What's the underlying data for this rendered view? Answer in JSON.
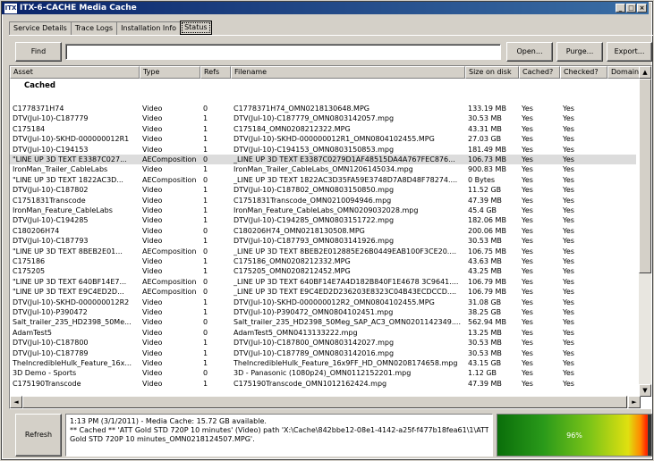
{
  "window": {
    "icon_label": "ITX",
    "title": "ITX-6-CACHE Media Cache",
    "controls": {
      "minimize": "_",
      "maximize": "□",
      "close": "×"
    }
  },
  "tabs": [
    {
      "label": "Service Details",
      "active": false
    },
    {
      "label": "Trace Logs",
      "active": false
    },
    {
      "label": "Installation Info",
      "active": false
    },
    {
      "label": "Status",
      "active": true
    }
  ],
  "toolbar": {
    "find_label": "Find",
    "search_value": "",
    "open_label": "Open...",
    "purge_label": "Purge...",
    "export_label": "Export..."
  },
  "grid": {
    "columns": [
      "Asset",
      "Type",
      "Refs",
      "Filename",
      "Size on disk",
      "Cached?",
      "Checked?",
      "Domain"
    ],
    "group_label": "Cached",
    "rows": [
      [
        "C1778371H74",
        "Video",
        "0",
        "C1778371H74_OMN0218130648.MPG",
        "133.19 MB",
        "Yes",
        "Yes"
      ],
      [
        "DTV(Jul-10)-C187779",
        "Video",
        "1",
        "DTV(Jul-10)-C187779_OMN0803142057.mpg",
        "30.53 MB",
        "Yes",
        "Yes"
      ],
      [
        "C175184",
        "Video",
        "1",
        "C175184_OMN0208212322.MPG",
        "43.31 MB",
        "Yes",
        "Yes"
      ],
      [
        "DTV(Jul-10)-SKHD-000000012R1",
        "Video",
        "1",
        "DTV(Jul-10)-SKHD-000000012R1_OMN0804102455.MPG",
        "27.03 GB",
        "Yes",
        "Yes"
      ],
      [
        "DTV(Jul-10)-C194153",
        "Video",
        "1",
        "DTV(Jul-10)-C194153_OMN0803150853.mpg",
        "181.49 MB",
        "Yes",
        "Yes"
      ],
      [
        "\"LINE UP 3D TEXT E3387C027...",
        "AEComposition",
        "0",
        "_LINE UP 3D TEXT E3387C0279D1AF48515DA4A767FEC876...",
        "106.73 MB",
        "Yes",
        "Yes"
      ],
      [
        "IronMan_Trailer_CableLabs",
        "Video",
        "1",
        "IronMan_Trailer_CableLabs_OMN1206145034.mpg",
        "900.83 MB",
        "Yes",
        "Yes"
      ],
      [
        "\"LINE UP 3D TEXT 1822AC3D...",
        "AEComposition",
        "0",
        "_LINE UP 3D TEXT 1822AC3D35FA59E3748D7A8D48F78274....",
        "0 Bytes",
        "Yes",
        "Yes"
      ],
      [
        "DTV(Jul-10)-C187802",
        "Video",
        "1",
        "DTV(Jul-10)-C187802_OMN0803150850.mpg",
        "11.52 GB",
        "Yes",
        "Yes"
      ],
      [
        "C1751831Transcode",
        "Video",
        "1",
        "C1751831Transcode_OMN0210094946.mpg",
        "47.39 MB",
        "Yes",
        "Yes"
      ],
      [
        "IronMan_Feature_CableLabs",
        "Video",
        "1",
        "IronMan_Feature_CableLabs_OMN0209032028.mpg",
        "45.4 GB",
        "Yes",
        "Yes"
      ],
      [
        "DTV(Jul-10)-C194285",
        "Video",
        "1",
        "DTV(Jul-10)-C194285_OMN0803151722.mpg",
        "182.06 MB",
        "Yes",
        "Yes"
      ],
      [
        "C180206H74",
        "Video",
        "0",
        "C180206H74_OMN0218130508.MPG",
        "200.06 MB",
        "Yes",
        "Yes"
      ],
      [
        "DTV(Jul-10)-C187793",
        "Video",
        "1",
        "DTV(Jul-10)-C187793_OMN0803141926.mpg",
        "30.53 MB",
        "Yes",
        "Yes"
      ],
      [
        "\"LINE UP 3D TEXT 8BEB2E01...",
        "AEComposition",
        "0",
        "_LINE UP 3D TEXT 8BEB2E012885E26B0449EAB100F3CE20....",
        "106.75 MB",
        "Yes",
        "Yes"
      ],
      [
        "C175186",
        "Video",
        "1",
        "C175186_OMN0208212332.MPG",
        "43.63 MB",
        "Yes",
        "Yes"
      ],
      [
        "C175205",
        "Video",
        "1",
        "C175205_OMN0208212452.MPG",
        "43.25 MB",
        "Yes",
        "Yes"
      ],
      [
        "\"LINE UP 3D TEXT 640BF14E7...",
        "AEComposition",
        "0",
        "_LINE UP 3D TEXT 640BF14E7A4D182B840F1E4678 3C9641....",
        "106.79 MB",
        "Yes",
        "Yes"
      ],
      [
        "\"LINE UP 3D TEXT E9C4ED2D...",
        "AEComposition",
        "0",
        "_LINE UP 3D TEXT E9C4ED2D236203E8323C04B43ECDCCD....",
        "106.79 MB",
        "Yes",
        "Yes"
      ],
      [
        "DTV(Jul-10)-SKHD-000000012R2",
        "Video",
        "1",
        "DTV(Jul-10)-SKHD-000000012R2_OMN0804102455.MPG",
        "31.08 GB",
        "Yes",
        "Yes"
      ],
      [
        "DTV(Jul-10)-P390472",
        "Video",
        "1",
        "DTV(Jul-10)-P390472_OMN0804102451.mpg",
        "38.25 GB",
        "Yes",
        "Yes"
      ],
      [
        "Salt_trailer_235_HD2398_50Me...",
        "Video",
        "0",
        "Salt_trailer_235_HD2398_50Meg_SAP_AC3_OMN0201142349....",
        "562.94 MB",
        "Yes",
        "Yes"
      ],
      [
        "AdamTest5",
        "Video",
        "0",
        "AdamTest5_OMN0413133222.mpg",
        "13.25 MB",
        "Yes",
        "Yes"
      ],
      [
        "DTV(Jul-10)-C187800",
        "Video",
        "1",
        "DTV(Jul-10)-C187800_OMN0803142027.mpg",
        "30.53 MB",
        "Yes",
        "Yes"
      ],
      [
        "DTV(Jul-10)-C187789",
        "Video",
        "1",
        "DTV(Jul-10)-C187789_OMN0803142016.mpg",
        "30.53 MB",
        "Yes",
        "Yes"
      ],
      [
        "TheIncredibleHulk_Feature_16x...",
        "Video",
        "1",
        "TheIncredibleHulk_Feature_16x9FF_HD_OMN0208174658.mpg",
        "43.15 GB",
        "Yes",
        "Yes"
      ],
      [
        "3D Demo - Sports",
        "Video",
        "0",
        "3D - Panasonic (1080p24)_OMN0112152201.mpg",
        "1.12 GB",
        "Yes",
        "Yes"
      ],
      [
        "C175190Transcode",
        "Video",
        "1",
        "C175190Transcode_OMN1012162424.mpg",
        "47.39 MB",
        "Yes",
        "Yes"
      ]
    ],
    "selected_row": 5
  },
  "bottom": {
    "refresh_label": "Refresh",
    "status_line1": "1:13 PM (3/1/2011) - Media Cache: 15.72 GB available.",
    "status_line2": "** Cached ** 'ATT Gold STD 720P 10 minutes' (Video) path 'X:\\Cache\\842bbe12-08e1-4142-a25f-f477b18fea61\\1\\ATT",
    "status_line3": "Gold STD 720P 10 minutes_OMN0218124507.MPG'.",
    "gauge_label": "96%",
    "gauge_fraction": 0.96
  },
  "icons": {
    "scroll_up": "▲",
    "scroll_down": "▼",
    "scroll_left": "◄",
    "scroll_right": "►"
  }
}
